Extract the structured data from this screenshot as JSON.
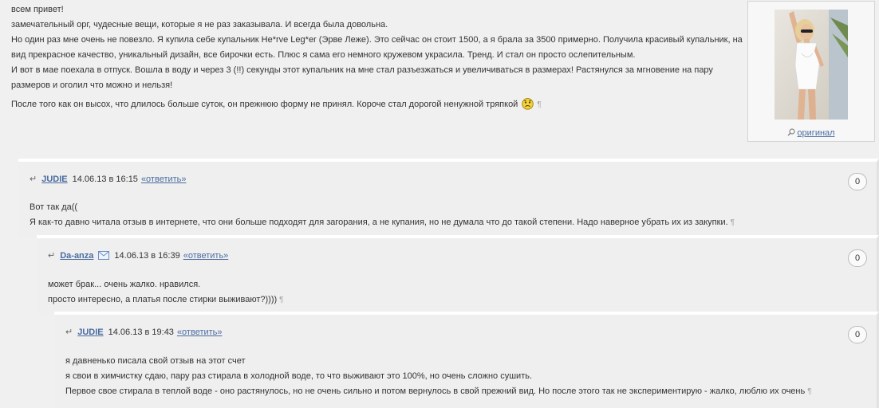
{
  "post": {
    "greeting": "всем привет!",
    "line1": "замечательный орг, чудесные вещи, которые я не раз заказывала. И всегда была довольна.",
    "line2": "Но один раз мне очень не повезло. Я купила себе купальник He*rve Leg*er (Эрве Леже). Это сейчас он стоит 1500, а я брала за 3500 примерно. Получила красивый купальник, на",
    "line3": "вид прекрасное качество, уникальный дизайн, все бирочки есть. Плюс я сама его немного кружевом украсила. Тренд. И стал он просто ослепительным.",
    "line4": "И вот в мае поехала в отпуск. Вошла в воду и через 3 (!!) секунды этот купальник на мне стал разъезжаться и увеличиваться в размерах! Растянулся за мгновение на пару",
    "line5": "размеров и оголил что можно и нельзя!",
    "line6": "После того как он высох, что длилось больше суток, он прежнюю форму не принял. Короче стал дорогой ненужной тряпкой",
    "pilcrow": "¶",
    "original_link": "оригинал"
  },
  "comments": [
    {
      "arrow": "↵",
      "author": "JUDIE",
      "date": "14.06.13 в 16:15",
      "reply": "«ответить»",
      "rating": "0",
      "line1": "Вот так да((",
      "line2": "Я как-то давно читала отзыв в интернете, что они больше подходят для загорания, а не купания, но не думала что до такой степени. Надо наверное убрать их из закупки.",
      "pilcrow": "¶"
    },
    {
      "arrow": "↵",
      "author": "Da-anza",
      "date": "14.06.13 в 16:39",
      "reply": "«ответить»",
      "rating": "0",
      "line1": "может брак... очень жалко. нравился.",
      "line2": "просто интересно, а платья после стирки выживают?))))",
      "pilcrow": "¶"
    },
    {
      "arrow": "↵",
      "author": "JUDIE",
      "date": "14.06.13 в 19:43",
      "reply": "«ответить»",
      "rating": "0",
      "line1": "я давненько писала свой отзыв на этот счет",
      "line2": "я свои в химчистку сдаю, пару раз стирала в холодной воде, то что выживают это 100%, но очень сложно сушить.",
      "line3": "Первое свое стирала в теплой воде - оно растянулось, но не очень сильно и потом вернулось в свой прежний вид. Но после этого так не экспериментирую - жалко, люблю их очень",
      "pilcrow": "¶"
    }
  ]
}
